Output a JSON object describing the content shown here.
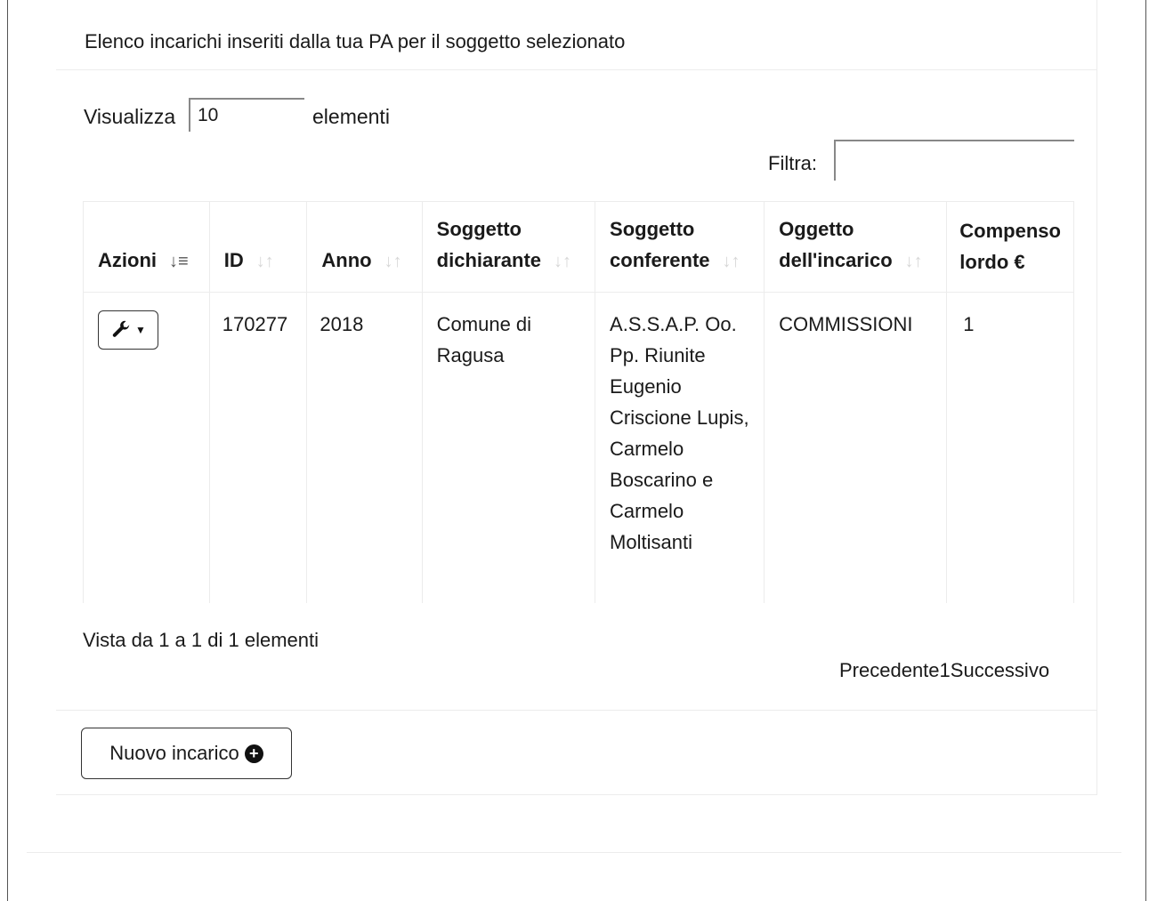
{
  "heading": "Elenco incarichi inseriti dalla tua PA per il soggetto selezionato",
  "length_menu": {
    "prefix": "Visualizza",
    "value": "10",
    "suffix": "elementi"
  },
  "filter": {
    "label": "Filtra:",
    "value": ""
  },
  "table": {
    "columns": [
      {
        "label": "Azioni",
        "sort": "active-asc"
      },
      {
        "label": "ID",
        "sort": "both"
      },
      {
        "label": "Anno",
        "sort": "both"
      },
      {
        "label": "Soggetto dichiarante",
        "sort": "both"
      },
      {
        "label": "Soggetto conferente",
        "sort": "both"
      },
      {
        "label": "Oggetto dell'incarico",
        "sort": "both"
      },
      {
        "label": "Compenso lordo €",
        "sort": "none"
      }
    ],
    "rows": [
      {
        "action_icon": "wrench-icon",
        "id": "170277",
        "anno": "2018",
        "dichiarante": "Comune di Ragusa",
        "conferente": "A.S.S.A.P. Oo. Pp. Riunite Eugenio Criscione Lupis, Carmelo Boscarino e Carmelo Moltisanti",
        "oggetto": "COMMISSIONI",
        "compenso": "1"
      }
    ]
  },
  "info": "Vista da 1 a 1 di 1 elementi",
  "pagination": {
    "previous": "Precedente",
    "current": "1",
    "next": "Successivo"
  },
  "new_button": {
    "label": "Nuovo incarico",
    "icon": "plus-circle-icon"
  }
}
